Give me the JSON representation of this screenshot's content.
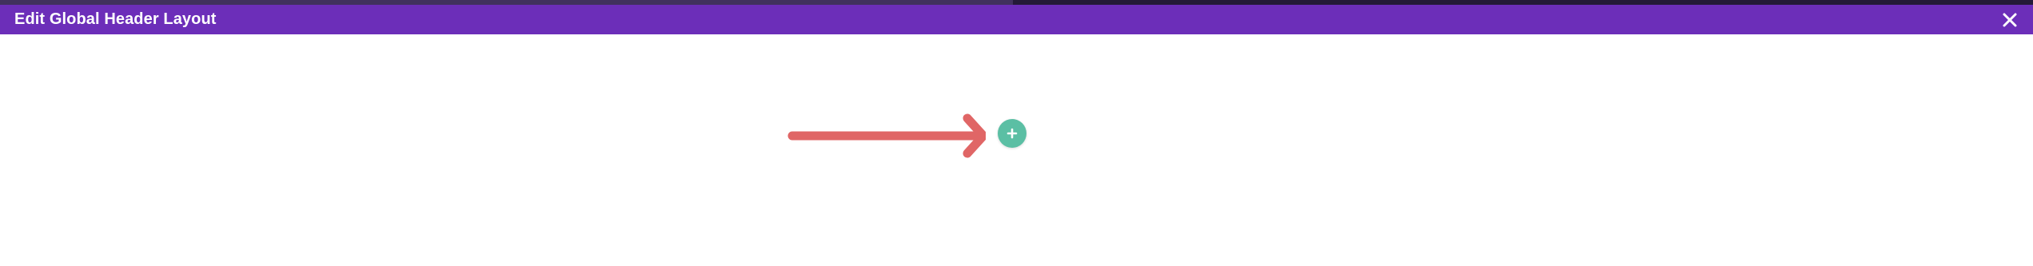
{
  "modal": {
    "title": "Edit Global Header Layout",
    "close_icon": "close-icon"
  },
  "canvas": {
    "add_button_icon": "plus-icon",
    "annotation_icon": "arrow-right-icon"
  },
  "colors": {
    "header_bg": "#6c2eb9",
    "add_button": "#5bbfa4",
    "annotation_arrow": "#e06666"
  }
}
